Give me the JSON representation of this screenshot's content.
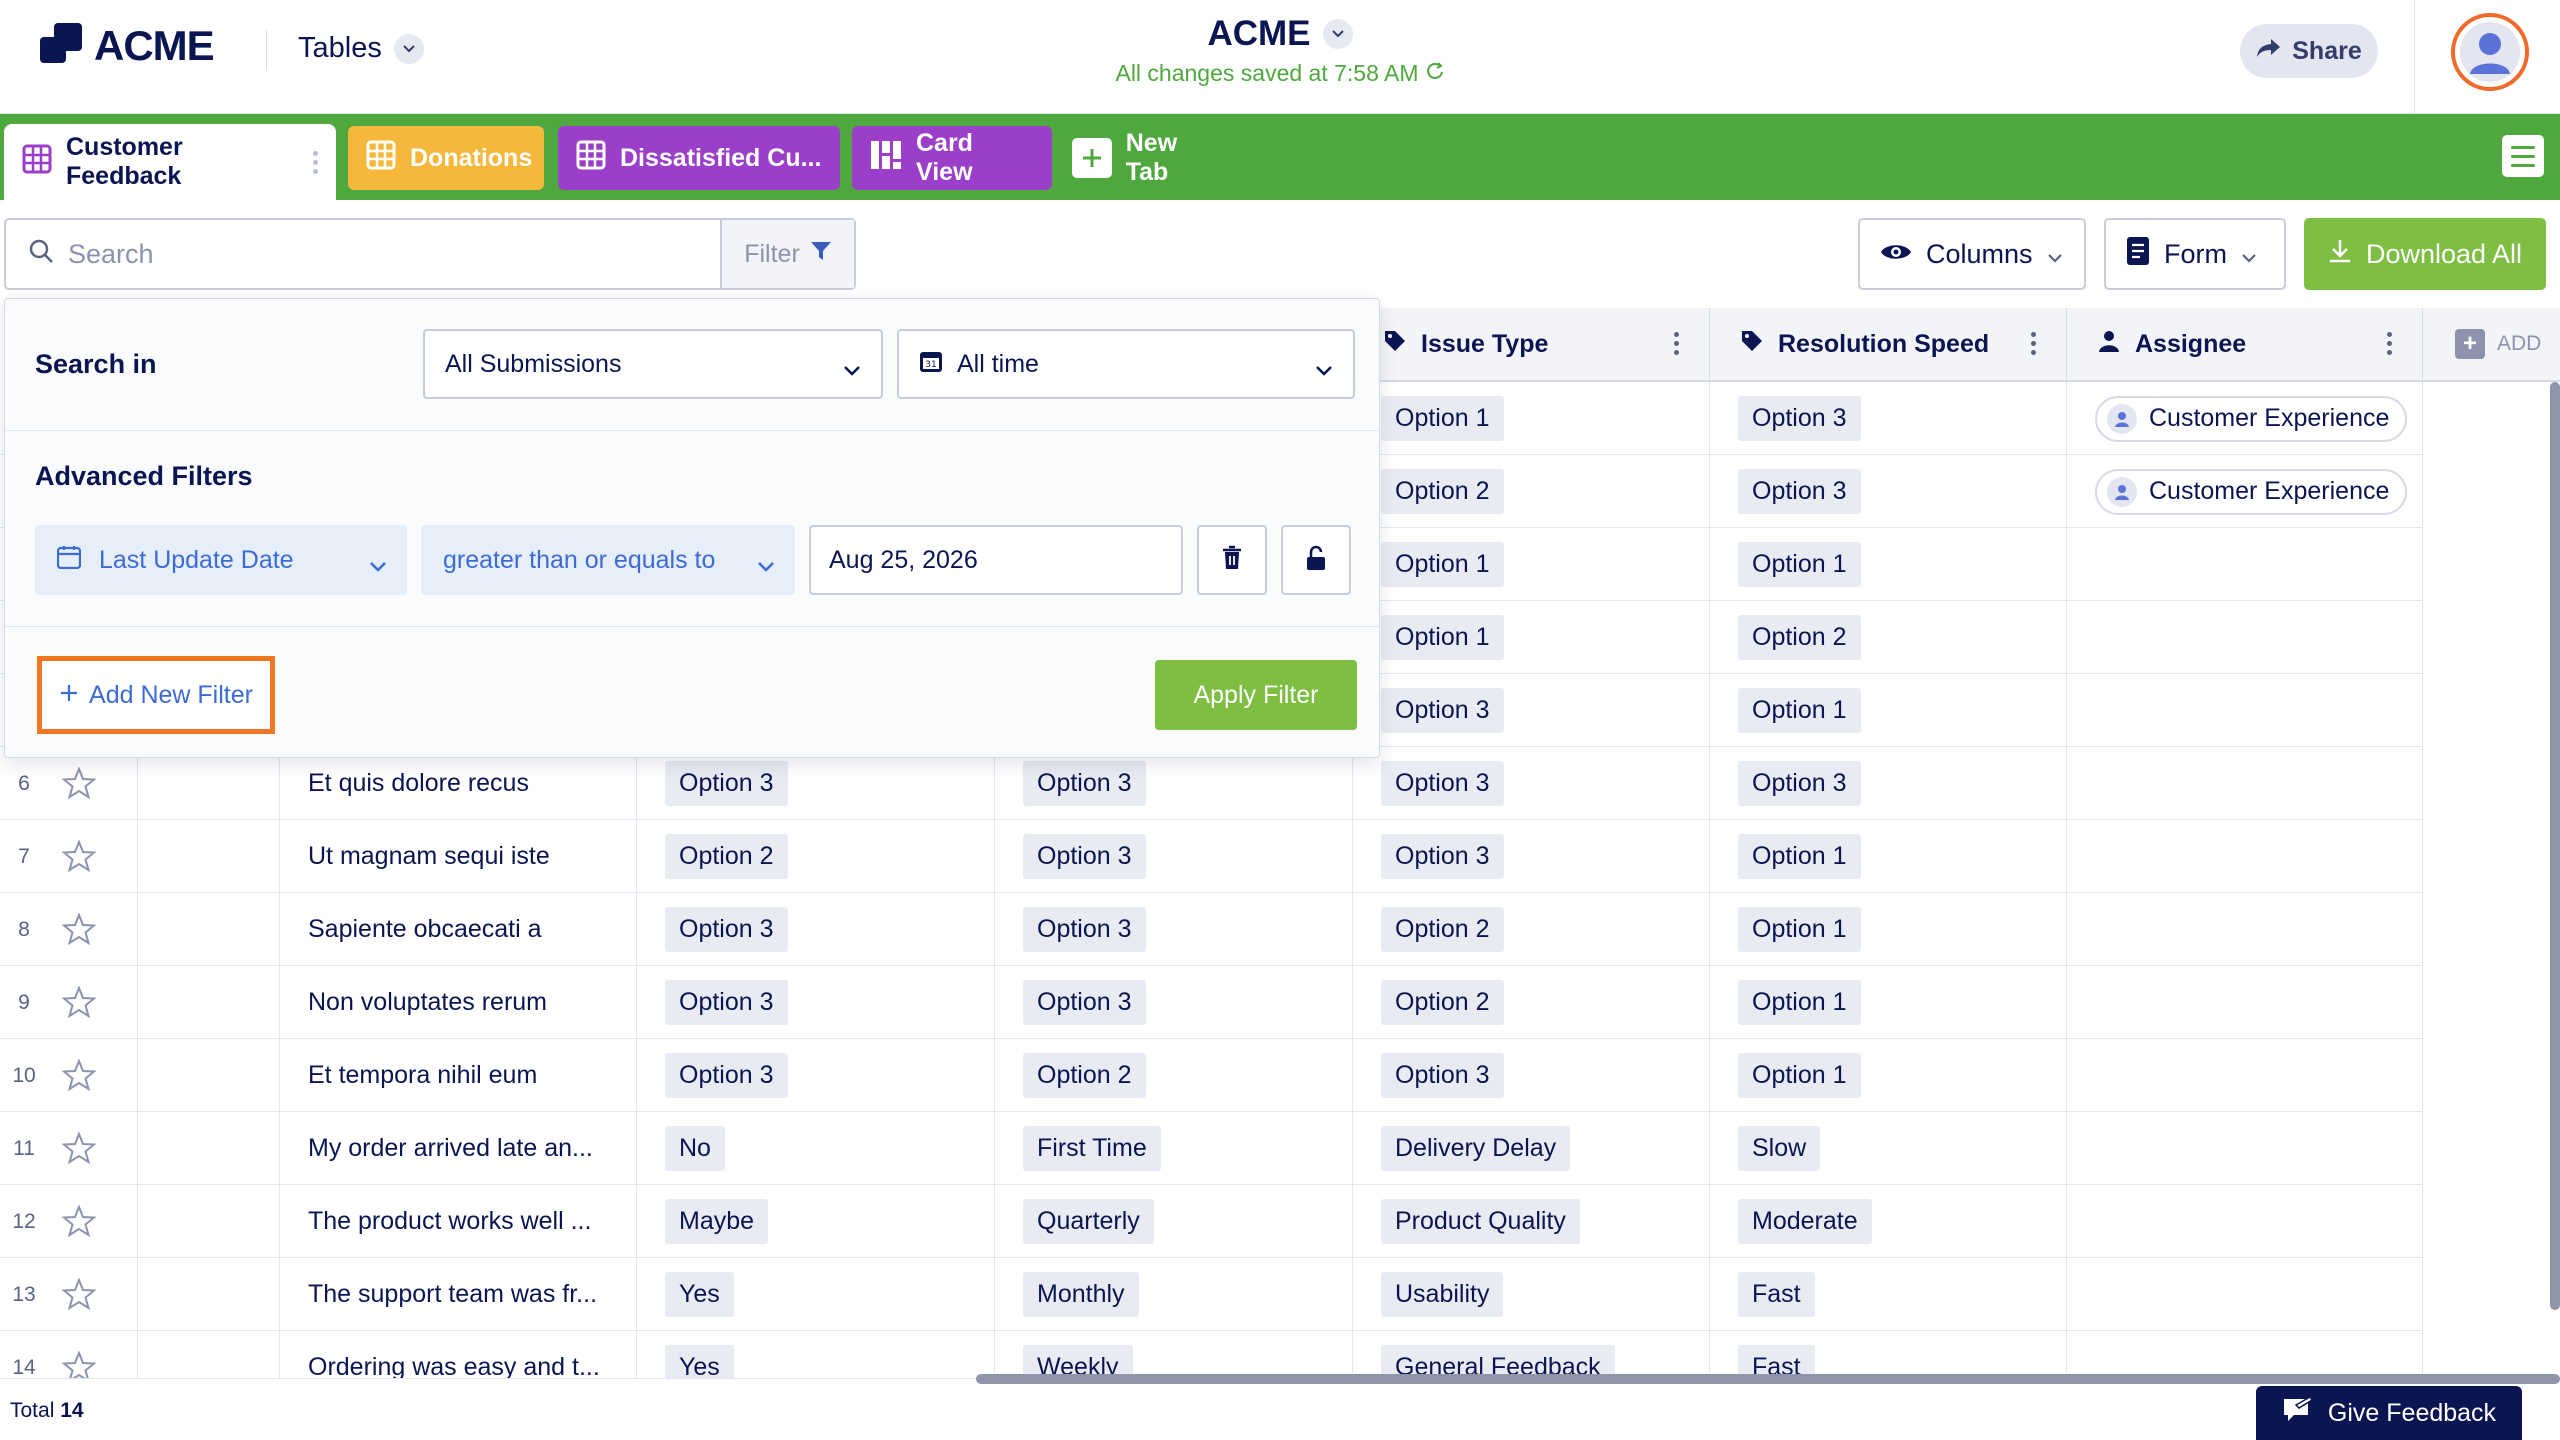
{
  "header": {
    "logo_text": "ACME",
    "tables_label": "Tables",
    "form_title": "ACME",
    "saved_status": "All changes saved at 7:58 AM",
    "share_label": "Share"
  },
  "tabs": [
    {
      "label": "Customer Feedback"
    },
    {
      "label": "Donations"
    },
    {
      "label": "Dissatisfied Cu..."
    },
    {
      "label": "Card View"
    },
    {
      "label": "New Tab"
    }
  ],
  "toolbar": {
    "search_placeholder": "Search",
    "filter_label": "Filter",
    "columns_label": "Columns",
    "form_label": "Form",
    "download_label": "Download All"
  },
  "columns": {
    "issue_type": "Issue Type",
    "resolution_speed": "Resolution Speed",
    "assignee": "Assignee",
    "add_label": "ADD"
  },
  "rows": [
    {
      "idx": "",
      "text": "",
      "c1": "",
      "c2": "",
      "issue": "Option 1",
      "speed": "Option 3",
      "assignee": "Customer Experience"
    },
    {
      "idx": "",
      "text": "",
      "c1": "",
      "c2": "",
      "issue": "Option 2",
      "speed": "Option 3",
      "assignee": "Customer Experience"
    },
    {
      "idx": "",
      "text": "",
      "c1": "",
      "c2": "",
      "issue": "Option 1",
      "speed": "Option 1",
      "assignee": ""
    },
    {
      "idx": "",
      "text": "",
      "c1": "",
      "c2": "",
      "issue": "Option 1",
      "speed": "Option 2",
      "assignee": ""
    },
    {
      "idx": "",
      "text": "",
      "c1": "",
      "c2": "",
      "issue": "Option 3",
      "speed": "Option 1",
      "assignee": ""
    },
    {
      "idx": "6",
      "text": "Et quis dolore recus",
      "c1": "Option 3",
      "c2": "Option 3",
      "issue": "Option 3",
      "speed": "Option 3",
      "assignee": ""
    },
    {
      "idx": "7",
      "text": "Ut magnam sequi iste",
      "c1": "Option 2",
      "c2": "Option 3",
      "issue": "Option 3",
      "speed": "Option 1",
      "assignee": ""
    },
    {
      "idx": "8",
      "text": "Sapiente obcaecati a",
      "c1": "Option 3",
      "c2": "Option 3",
      "issue": "Option 2",
      "speed": "Option 1",
      "assignee": ""
    },
    {
      "idx": "9",
      "text": "Non voluptates rerum",
      "c1": "Option 3",
      "c2": "Option 3",
      "issue": "Option 2",
      "speed": "Option 1",
      "assignee": ""
    },
    {
      "idx": "10",
      "text": "Et tempora nihil eum",
      "c1": "Option 3",
      "c2": "Option 2",
      "issue": "Option 3",
      "speed": "Option 1",
      "assignee": ""
    },
    {
      "idx": "11",
      "text": "My order arrived late an...",
      "c1": "No",
      "c2": "First Time",
      "issue": "Delivery Delay",
      "speed": "Slow",
      "assignee": ""
    },
    {
      "idx": "12",
      "text": "The product works well ...",
      "c1": "Maybe",
      "c2": "Quarterly",
      "issue": "Product Quality",
      "speed": "Moderate",
      "assignee": ""
    },
    {
      "idx": "13",
      "text": "The support team was fr...",
      "c1": "Yes",
      "c2": "Monthly",
      "issue": "Usability",
      "speed": "Fast",
      "assignee": ""
    },
    {
      "idx": "14",
      "text": "Ordering was easy and t...",
      "c1": "Yes",
      "c2": "Weekly",
      "issue": "General Feedback",
      "speed": "Fast",
      "assignee": ""
    }
  ],
  "footer": {
    "total_label": "Total",
    "total_count": "14",
    "give_feedback": "Give Feedback"
  },
  "filter_panel": {
    "search_in_label": "Search in",
    "submissions_value": "All Submissions",
    "time_value": "All time",
    "advanced_label": "Advanced Filters",
    "field_value": "Last Update Date",
    "operator_value": "greater than or equals to",
    "date_value": "Aug 25, 2026",
    "add_filter_label": "Add New Filter",
    "apply_label": "Apply Filter"
  },
  "colors": {
    "brand_green": "#4fa83d",
    "action_green": "#7dbe43",
    "navy": "#0a1551",
    "donations_tab": "#f5b83a",
    "purple_tab": "#9b3ec9",
    "highlight_orange": "#f07823",
    "link_blue": "#3d6bd6"
  },
  "icons": [
    "logo-icon",
    "chevron-down-icon",
    "refresh-icon",
    "share-icon",
    "user-avatar-icon",
    "grid-icon",
    "card-view-icon",
    "plus-icon",
    "menu-icon",
    "search-icon",
    "funnel-icon",
    "eye-icon",
    "form-icon",
    "download-icon",
    "tag-icon",
    "person-icon",
    "star-icon",
    "calendar-icon",
    "trash-icon",
    "unlock-icon",
    "feedback-icon"
  ]
}
